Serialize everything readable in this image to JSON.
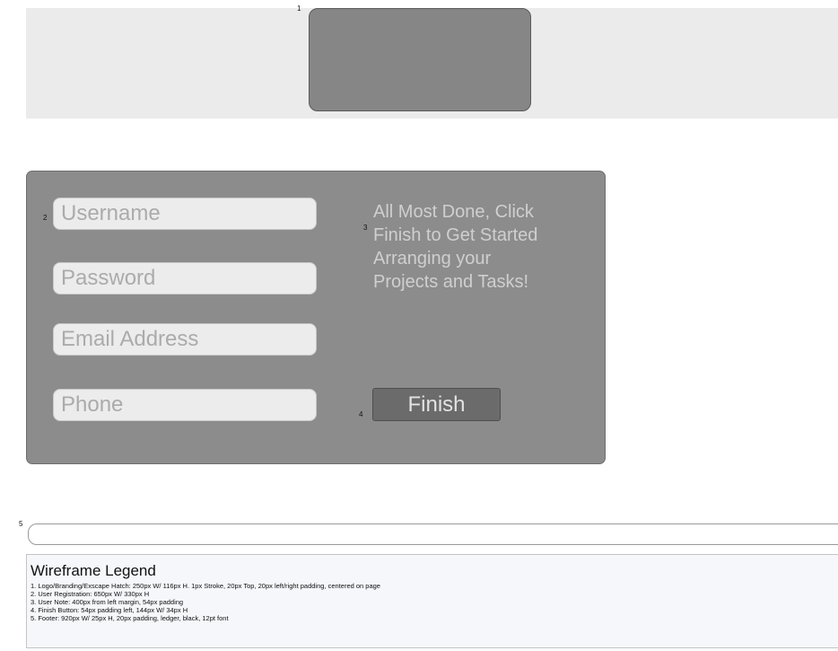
{
  "header": {
    "marker": "1"
  },
  "registration": {
    "marker": "2",
    "fields": [
      {
        "name": "username-field",
        "placeholder": "Username"
      },
      {
        "name": "password-field",
        "placeholder": "Password"
      },
      {
        "name": "email-field",
        "placeholder": "Email Address"
      },
      {
        "name": "phone-field",
        "placeholder": "Phone"
      }
    ]
  },
  "note": {
    "marker": "3",
    "text": "All Most Done, Click Finish to Get Started Arranging your Projects and Tasks!"
  },
  "finish": {
    "marker": "4",
    "label": "Finish"
  },
  "footer": {
    "marker": "5"
  },
  "legend": {
    "title": "Wireframe Legend",
    "items": [
      "1. Logo/Branding/Exscape Hatch: 250px W/ 116px H. 1px Stroke, 20px Top, 20px left/right padding, centered on page",
      "2. User Registration: 650px W/ 330px H",
      "3. User Note: 400px from left margin, 54px padding",
      "4. Finish Button: 54px padding left, 144px W/ 34px H",
      "5. Footer: 920px W/ 25px H, 20px padding, ledger, black, 12pt font"
    ]
  }
}
